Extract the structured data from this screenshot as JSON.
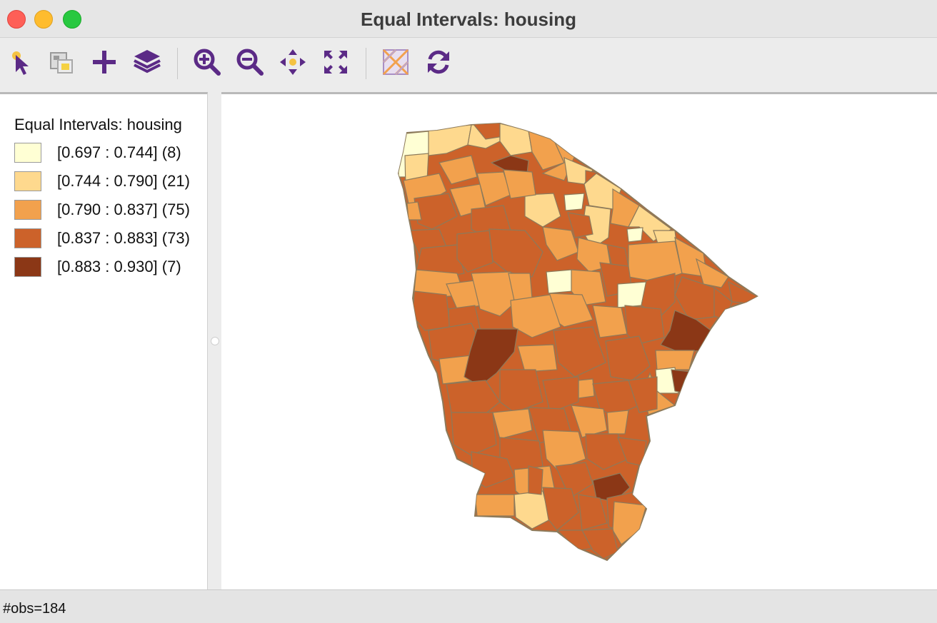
{
  "window": {
    "title": "Equal Intervals: housing"
  },
  "toolbar": {
    "tools": [
      {
        "icon": "select-pointer-icon"
      },
      {
        "icon": "selection-shape-icon"
      },
      {
        "icon": "add-icon"
      },
      {
        "icon": "layers-icon"
      },
      {
        "icon": "zoom-in-icon"
      },
      {
        "icon": "zoom-out-icon"
      },
      {
        "icon": "pan-icon"
      },
      {
        "icon": "full-extent-icon"
      },
      {
        "icon": "basemap-icon"
      },
      {
        "icon": "refresh-icon"
      }
    ]
  },
  "legend": {
    "title": "Equal Intervals: housing",
    "classes": [
      {
        "label": "[0.697 : 0.744] (8)",
        "color": "#ffffd4"
      },
      {
        "label": "[0.744 : 0.790] (21)",
        "color": "#fed98e"
      },
      {
        "label": "[0.790 : 0.837] (75)",
        "color": "#f2a14d"
      },
      {
        "label": "[0.837 : 0.883] (73)",
        "color": "#cc622a"
      },
      {
        "label": "[0.883 : 0.930] (7)",
        "color": "#8b3716"
      }
    ]
  },
  "status": {
    "text": "#obs=184"
  }
}
